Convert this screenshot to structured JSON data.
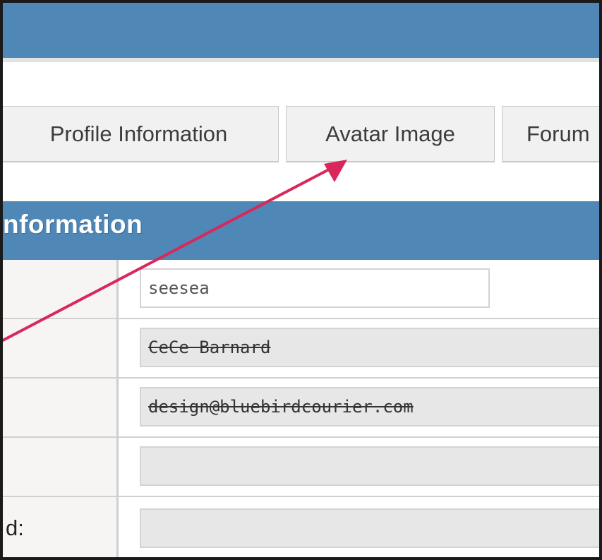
{
  "tabs": {
    "profile_label": "Profile Information",
    "avatar_label": "Avatar Image",
    "forum_label": "Forum"
  },
  "section": {
    "title": "nformation"
  },
  "form": {
    "username_value": "seesea",
    "name_value": "CeCe Barnard",
    "email_value": "design@bluebirdcourier.com",
    "field4_value": "",
    "field5_label": "d:",
    "field5_value": ""
  },
  "colors": {
    "header_blue": "#4f87b6",
    "annotation_arrow": "#d9275b"
  },
  "icons": {
    "annotation": "annotation-arrow-icon"
  }
}
